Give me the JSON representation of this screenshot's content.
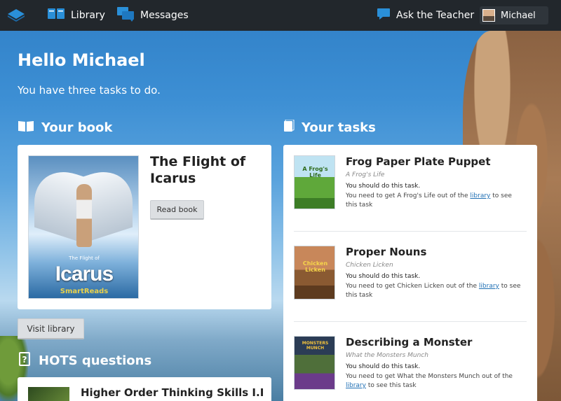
{
  "topbar": {
    "library_label": "Library",
    "messages_label": "Messages",
    "ask_teacher_label": "Ask the Teacher",
    "user_name": "Michael"
  },
  "greeting": "Hello Michael",
  "subtitle": "You have three tasks to do.",
  "your_book": {
    "heading": "Your book",
    "title": "The Flight of Icarus",
    "read_button": "Read book",
    "cover": {
      "small_text": "The Flight of",
      "big_text": "Icarus",
      "brand": "SmartReads"
    }
  },
  "visit_library_button": "Visit library",
  "your_tasks": {
    "heading": "Your tasks",
    "tasks": [
      {
        "title": "Frog Paper Plate Puppet",
        "book": "A Frog's Life",
        "should": "You should do this task.",
        "note_pre": "You need to get A Frog's Life out of the ",
        "note_link": "library",
        "note_post": " to see this task",
        "cover_text": "A Frog's Life"
      },
      {
        "title": "Proper Nouns",
        "book": "Chicken Licken",
        "should": "You should do this task.",
        "note_pre": "You need to get Chicken Licken out of the ",
        "note_link": "library",
        "note_post": " to see this task",
        "cover_text": "Chicken Licken"
      },
      {
        "title": "Describing a Monster",
        "book": "What the Monsters Munch",
        "should": "You should do this task.",
        "note_pre": "You need to get What the Monsters Munch out of the ",
        "note_link": "library",
        "note_post": " to see this task",
        "cover_text": "MONSTERS MUNCH"
      }
    ]
  },
  "hots": {
    "heading": "HOTS questions",
    "item_title": "Higher Order Thinking Skills I.I"
  },
  "colors": {
    "topbar": "#22272c",
    "accent_blue": "#2a8fd8",
    "link": "#1f6fb4"
  },
  "icons": [
    "book-stack-logo-icon",
    "library-book-icon",
    "messages-icon",
    "chat-bubble-icon",
    "open-book-icon",
    "single-book-icon",
    "question-icon"
  ]
}
